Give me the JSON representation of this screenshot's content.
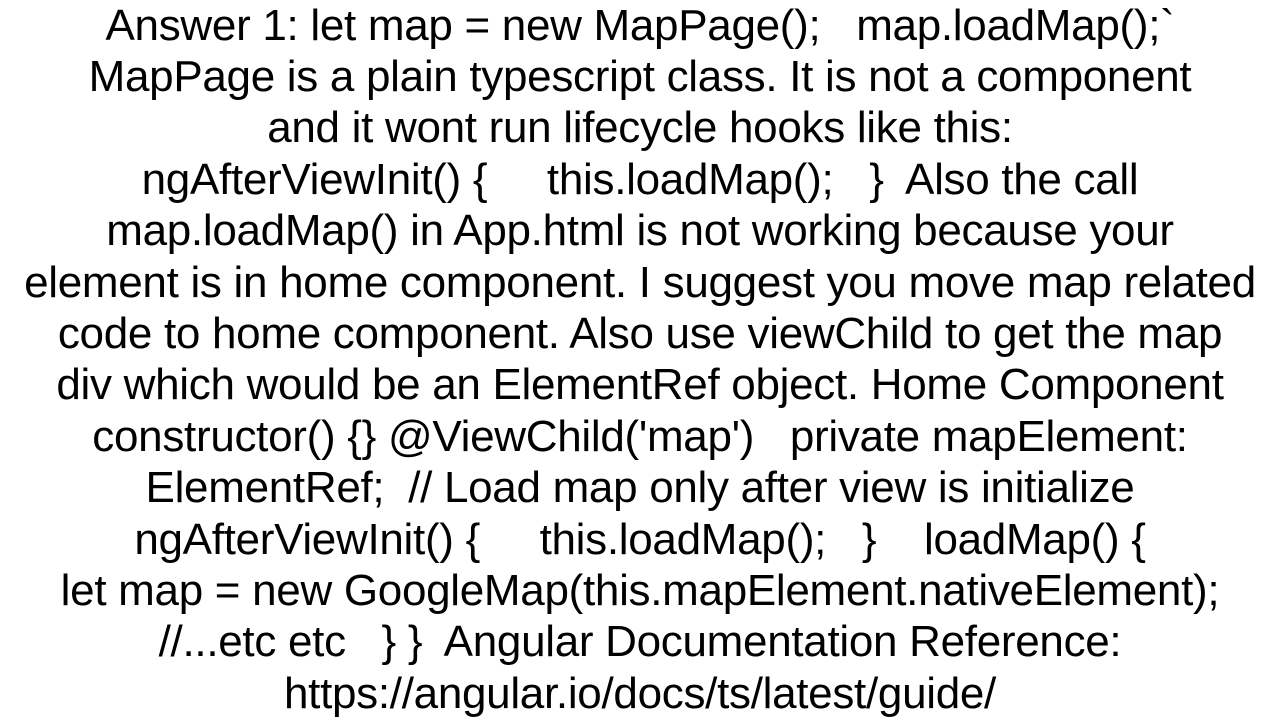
{
  "document": {
    "lines": [
      "Answer 1: let map = new MapPage();   map.loadMap();`",
      "MapPage is a plain typescript class. It is not a component",
      "and it wont run lifecycle hooks like this:",
      "ngAfterViewInit() {     this.loadMap();   }  Also the call",
      "map.loadMap() in App.html is not working because your",
      "element is in home component. I suggest you move map related",
      "code to home component. Also use viewChild to get the map",
      "div which would be an ElementRef object. Home Component",
      "constructor() {} @ViewChild('map')   private mapElement:",
      "ElementRef;  // Load map only after view is initialize",
      "ngAfterViewInit() {     this.loadMap();   }    loadMap() {",
      "let map = new GoogleMap(this.mapElement.nativeElement);",
      "//...etc etc   } }  Angular Documentation Reference:",
      "https://angular.io/docs/ts/latest/guide/"
    ]
  }
}
